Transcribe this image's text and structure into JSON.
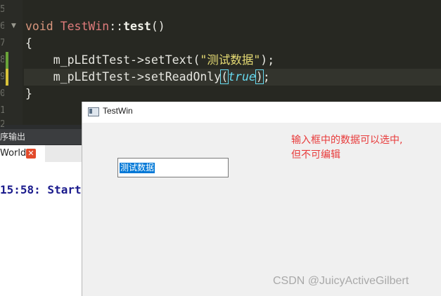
{
  "editor": {
    "line_numbers": [
      "5",
      "6",
      "7",
      "8",
      "9",
      "0",
      "1",
      "2"
    ],
    "code": {
      "l1_void": "void",
      "l1_class": "TestWin",
      "l1_sep": "::",
      "l1_fn": "test",
      "l1_parens": "()",
      "l2": "{",
      "l3_obj": "m_pLEdtTest",
      "l3_arrow": "->",
      "l3_method": "setText(",
      "l3_string": "\"测试数据\"",
      "l3_end": ");",
      "l4_obj": "m_pLEdtTest",
      "l4_arrow": "->",
      "l4_method": "setReadOnly",
      "l4_open": "(",
      "l4_literal": "true",
      "l4_close": ")",
      "l4_end": ";",
      "l5": "}"
    }
  },
  "output_panel": {
    "header": "序输出",
    "tab_label": "World",
    "tab_close": "✕",
    "log_line": "15:58: Start"
  },
  "window": {
    "title": "TestWin",
    "line_edit_value": "测试数据",
    "note_line1": "输入框中的数据可以选中,",
    "note_line2": "但不可编辑"
  },
  "watermark": "CSDN @JuicyActiveGilbert",
  "colors": {
    "editor_bg": "#272822",
    "selection": "#0078d7",
    "note": "#e83a3a"
  }
}
